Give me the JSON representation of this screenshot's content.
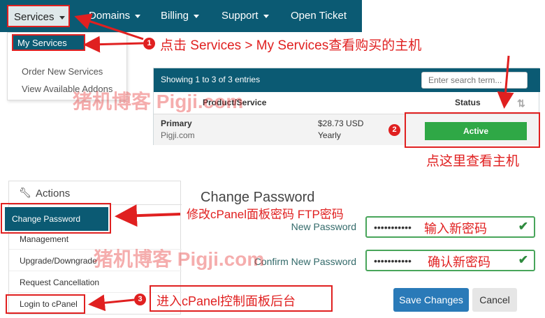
{
  "nav": {
    "services": "Services",
    "domains": "Domains",
    "billing": "Billing",
    "support": "Support",
    "open_ticket": "Open Ticket"
  },
  "dropdown": {
    "my_services": "My Services",
    "order_new": "Order New Services",
    "view_addons": "View Available Addons"
  },
  "table": {
    "info": "Showing 1 to 3 of 3 entries",
    "search_placeholder": "Enter search term...",
    "col_product": "Product/Service",
    "col_status": "Status",
    "row": {
      "product": "Primary",
      "domain": "Pigji.com",
      "price": "$28.73 USD",
      "cycle": "Yearly",
      "status": "Active"
    }
  },
  "actions": {
    "title": "Actions",
    "items": [
      "Change Password",
      "Management",
      "Upgrade/Downgrade",
      "Request Cancellation",
      "Login to cPanel"
    ]
  },
  "form": {
    "title": "Change Password",
    "new_label": "New Password",
    "confirm_label": "Confirm New Password",
    "masked": "•••••••••••",
    "save": "Save Changes",
    "cancel": "Cancel"
  },
  "annotations": {
    "step1_num": "1",
    "step1": "点击 Services > My Services查看购买的主机",
    "step2_num": "2",
    "step2": "点这里查看主机",
    "modify": "修改cPanel面板密码 FTP密码",
    "input_new": "输入新密码",
    "confirm_new": "确认新密码",
    "step3_num": "3",
    "step3": "进入cPanel控制面板后台",
    "watermark": "猪机博客 Pigji.com"
  },
  "colors": {
    "primary": "#0b5a73",
    "annotation_red": "#e02020",
    "active_green": "#2fa846",
    "save_blue": "#2a7ab8"
  }
}
